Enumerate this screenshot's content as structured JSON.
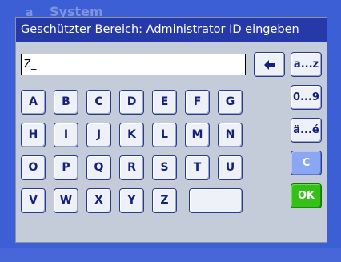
{
  "background": {
    "title": "System",
    "subtitle": "a"
  },
  "dialog": {
    "title": "Geschützter Bereich: Administrator ID eingeben",
    "input_value": "Z_"
  },
  "keyboard": {
    "rows": [
      [
        "A",
        "B",
        "C",
        "D",
        "E",
        "F",
        "G"
      ],
      [
        "H",
        "I",
        "J",
        "K",
        "L",
        "M",
        "N"
      ],
      [
        "O",
        "P",
        "Q",
        "R",
        "S",
        "T",
        "U"
      ],
      [
        "V",
        "W",
        "X",
        "Y",
        "Z"
      ]
    ],
    "backspace_icon": "backspace-arrow-icon",
    "mode_az": "a...z",
    "mode_09": "0...9",
    "mode_special": "ä...é",
    "clear": "C",
    "ok": "OK"
  },
  "colors": {
    "title_bar": "#253aa8",
    "dialog_bg": "#c4ccd9",
    "clear_key": "#8ba6f2",
    "ok_key": "#35c018"
  }
}
